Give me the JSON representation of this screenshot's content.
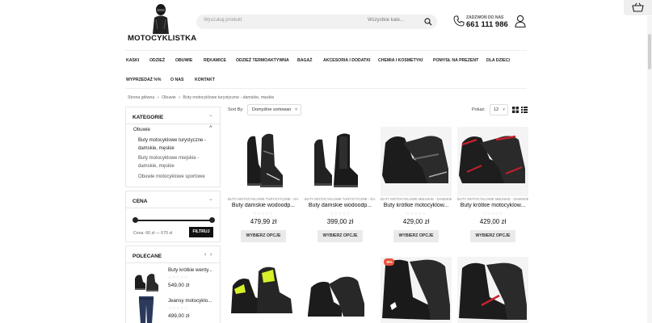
{
  "header": {
    "logo_text": "MOTOCYKLISTKA",
    "search_placeholder": "Wyszukaj produkt",
    "search_category": "Wszystkie kate...",
    "phone_label": "ZADZWOŃ DO NAS",
    "phone_number": "661 111 986"
  },
  "nav": {
    "items": [
      "KASKI",
      "ODZIEŻ",
      "OBUWIE",
      "RĘKAWICE",
      "ODZIEŻ TERMOAKTYWNA",
      "BAGAŻ",
      "AKCESORIA I DODATKI",
      "CHEMIA I KOSMETYKI",
      "POMYSŁ NA PREZENT",
      "DLA DZIECI",
      "WYPRZEDAŻ %%",
      "O NAS",
      "KONTAKT"
    ]
  },
  "breadcrumb": [
    "Strona główna",
    "Obuwie",
    "Buty motocyklowe turystyczne - damskie, męskie"
  ],
  "sidebar": {
    "categories_title": "KATEGORIE",
    "parent_category": "Obuwie",
    "categories": [
      "Buty motocyklowe turystyczne - damskie, męskie",
      "Buty motocyklowe miejskie - damskie, męskie",
      "Obuwie motocyklowe sportowe"
    ],
    "price_title": "CENA",
    "price_range": "Cena: 60 zł — 670 zł",
    "filter_label": "FILTRUJ",
    "recommended_title": "POLECANE",
    "recommended": [
      {
        "name": "Buty krótkie wenty...",
        "stars": "☆☆☆☆☆",
        "price": "549,00 zł"
      },
      {
        "name": "Jeansy motocyklo...",
        "stars": "☆☆☆☆☆",
        "price": "499,00 zł"
      }
    ]
  },
  "toolbar": {
    "sort_label": "Sort By:",
    "sort_value": "Domyślne sortowan",
    "show_label": "Pokaż:",
    "show_value": "12"
  },
  "products": [
    {
      "category": "BUTY MOTOCYKLOWE TURYSTYCZNE - DA...",
      "name": "Buty damskie wodoodp...",
      "stars": "☆☆☆☆☆",
      "price": "479,99 zł",
      "button": "WYBIERZ OPCJE"
    },
    {
      "category": "BUTY MOTOCYKLOWE TURYSTYCZNE - DA...",
      "name": "Buty damskie wodoodp...",
      "stars": "☆☆☆☆☆",
      "price": "399,00 zł",
      "button": "WYBIERZ OPCJE"
    },
    {
      "category": "BUTY MOTOCYKLOWE MIEJSKIE - DAMSKIE...",
      "name": "Buty krótkie motocyklow...",
      "stars": "☆☆☆☆☆",
      "price": "429,00 zł",
      "button": "WYBIERZ OPCJE"
    },
    {
      "category": "BUTY MOTOCYKLOWE MIEJSKIE - DAMSKIE...",
      "name": "Buty krótkie motocyklow...",
      "stars": "☆☆☆☆☆",
      "price": "429,00 zł",
      "button": "WYBIERZ OPCJE"
    }
  ],
  "second_row": {
    "badge": "-8%"
  }
}
